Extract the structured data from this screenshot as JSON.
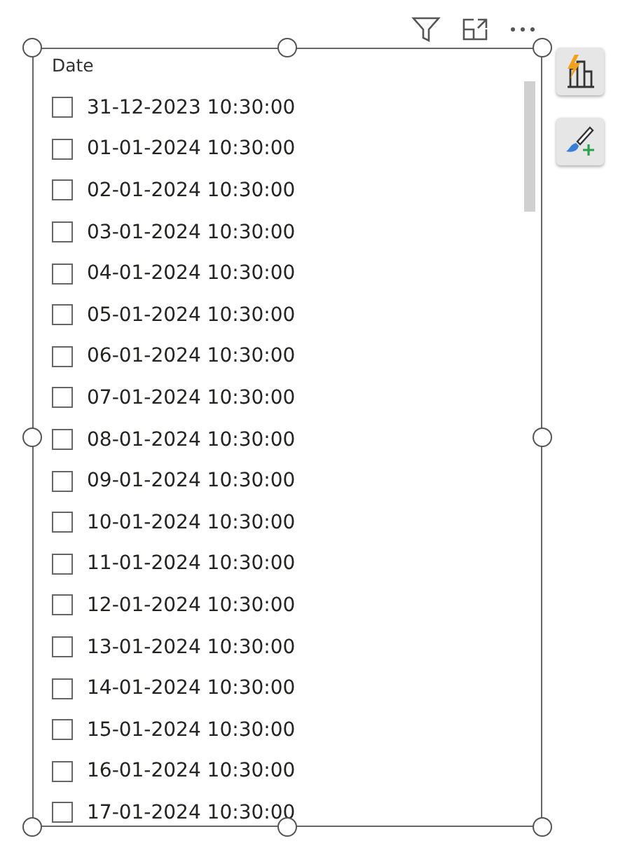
{
  "slicer": {
    "title": "Date",
    "items": [
      {
        "label": "31-12-2023 10:30:00",
        "checked": false
      },
      {
        "label": "01-01-2024 10:30:00",
        "checked": false
      },
      {
        "label": "02-01-2024 10:30:00",
        "checked": false
      },
      {
        "label": "03-01-2024 10:30:00",
        "checked": false
      },
      {
        "label": "04-01-2024 10:30:00",
        "checked": false
      },
      {
        "label": "05-01-2024 10:30:00",
        "checked": false
      },
      {
        "label": "06-01-2024 10:30:00",
        "checked": false
      },
      {
        "label": "07-01-2024 10:30:00",
        "checked": false
      },
      {
        "label": "08-01-2024 10:30:00",
        "checked": false
      },
      {
        "label": "09-01-2024 10:30:00",
        "checked": false
      },
      {
        "label": "10-01-2024 10:30:00",
        "checked": false
      },
      {
        "label": "11-01-2024 10:30:00",
        "checked": false
      },
      {
        "label": "12-01-2024 10:30:00",
        "checked": false
      },
      {
        "label": "13-01-2024 10:30:00",
        "checked": false
      },
      {
        "label": "14-01-2024 10:30:00",
        "checked": false
      },
      {
        "label": "15-01-2024 10:30:00",
        "checked": false
      },
      {
        "label": "16-01-2024 10:30:00",
        "checked": false
      },
      {
        "label": "17-01-2024 10:30:00",
        "checked": false
      }
    ]
  }
}
